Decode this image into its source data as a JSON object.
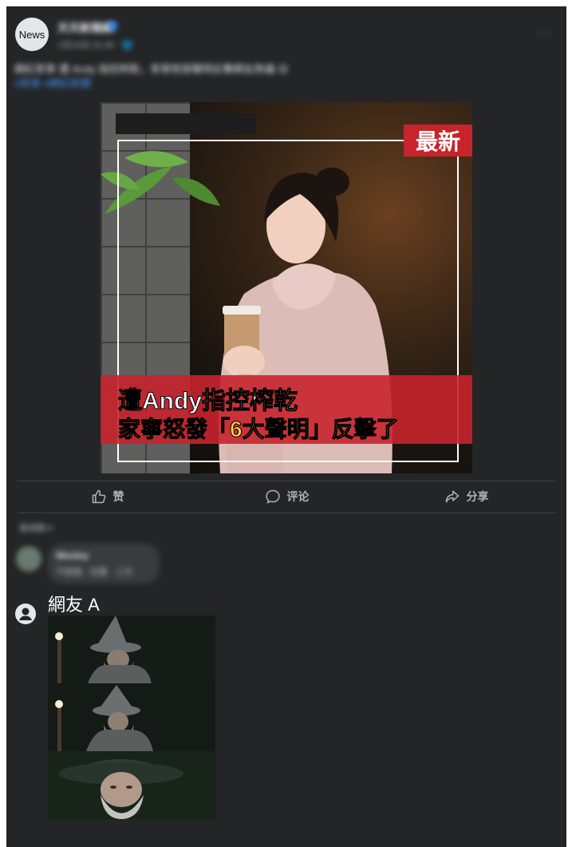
{
  "post": {
    "avatar_label": "News",
    "page_name": "天天新聞網",
    "meta": "1月14日 21:40 · 🌐",
    "more": "···",
    "caption": "網紅家寧 遭 Andy 指控榨乾，家寧怒發聲明反擊網友熱議 😮",
    "caption_link": "#家寧 #網紅新聞"
  },
  "image": {
    "badge": "最新",
    "headline1": "遭Andy指控榨乾",
    "headline2": "家寧怒發「6大聲明」反擊了"
  },
  "actions": [
    {
      "icon": "thumbs-up-icon",
      "label": "赞"
    },
    {
      "icon": "comment-icon",
      "label": "评论"
    },
    {
      "icon": "share-icon",
      "label": "分享"
    }
  ],
  "comments": {
    "sort_label": "最相關 ▾",
    "items": [
      {
        "name": "Wesley",
        "text": "不錯喔 · 回覆 · 三天"
      }
    ]
  },
  "reply": {
    "user_icon": "user-avatar-icon",
    "name": "網友 A"
  }
}
